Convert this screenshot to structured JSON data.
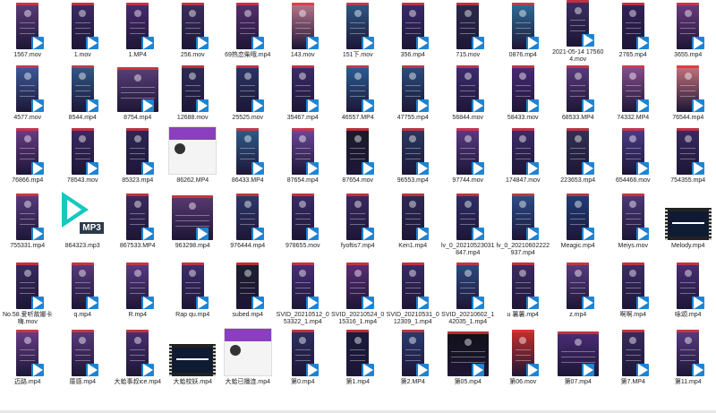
{
  "files": [
    {
      "name": "1567.mov",
      "kind": "phone",
      "bg": "#5c3d7a"
    },
    {
      "name": "1.mov",
      "kind": "phone",
      "bg": "#3d2b66"
    },
    {
      "name": "1.MP4",
      "kind": "phone",
      "bg": "#4a2c70"
    },
    {
      "name": "256.mov",
      "kind": "phone",
      "bg": "#3b2f5e"
    },
    {
      "name": "69热恋柴哦.mp4",
      "kind": "phone",
      "bg": "#57306f"
    },
    {
      "name": "143.mov",
      "kind": "phone",
      "bg": "#b9798e"
    },
    {
      "name": "151下.mov",
      "kind": "phone",
      "bg": "#2e5a86"
    },
    {
      "name": "356.mp4",
      "kind": "phone",
      "bg": "#3a2a6b"
    },
    {
      "name": "715.mov",
      "kind": "phone",
      "bg": "#2c2a4d"
    },
    {
      "name": "0876.mp4",
      "kind": "phone",
      "bg": "#2f6f9a"
    },
    {
      "name": "2021-05-14 175604.mov",
      "kind": "phone",
      "bg": "#3b2f63"
    },
    {
      "name": "2765.mp4",
      "kind": "phone",
      "bg": "#34225a"
    },
    {
      "name": "3655.mp4",
      "kind": "phone",
      "bg": "#6d3d80"
    },
    {
      "name": "4577.mov",
      "kind": "phone",
      "bg": "#3e5c9a"
    },
    {
      "name": "8544.mp4",
      "kind": "phone",
      "bg": "#315a8a"
    },
    {
      "name": "8754.mp4",
      "kind": "wide",
      "bg": "#5a3f79"
    },
    {
      "name": "12688.mov",
      "kind": "phone",
      "bg": "#2d2c59"
    },
    {
      "name": "25525.mov",
      "kind": "phone",
      "bg": "#2b3765"
    },
    {
      "name": "35467.mp4",
      "kind": "phone",
      "bg": "#3c2d69"
    },
    {
      "name": "46557.MP4",
      "kind": "phone",
      "bg": "#2b5f95"
    },
    {
      "name": "47755.mp4",
      "kind": "phone",
      "bg": "#2a4f7f"
    },
    {
      "name": "56844.mov",
      "kind": "phone",
      "bg": "#3e2d72"
    },
    {
      "name": "58433.mov",
      "kind": "phone",
      "bg": "#4b2b78"
    },
    {
      "name": "68533.MP4",
      "kind": "phone",
      "bg": "#5c3c7e"
    },
    {
      "name": "74332.MP4",
      "kind": "phone",
      "bg": "#8a4f8f"
    },
    {
      "name": "76544.mp4",
      "kind": "phone",
      "bg": "#c8747c"
    },
    {
      "name": "76866.mp4",
      "kind": "phone",
      "bg": "#6b3e86"
    },
    {
      "name": "78543.mov",
      "kind": "phone",
      "bg": "#3c2a63"
    },
    {
      "name": "85323.mp4",
      "kind": "phone",
      "bg": "#2e2857"
    },
    {
      "name": "86262.MP4",
      "kind": "doc",
      "bg": "#f4f4f4"
    },
    {
      "name": "86433.MP4",
      "kind": "phone",
      "bg": "#2e5e8f"
    },
    {
      "name": "87654.mp4",
      "kind": "phone",
      "bg": "#6e4a9a"
    },
    {
      "name": "87654.mov",
      "kind": "phone",
      "bg": "#1b1b2b"
    },
    {
      "name": "96553.mp4",
      "kind": "phone",
      "bg": "#2b3a62"
    },
    {
      "name": "97744.mov",
      "kind": "phone",
      "bg": "#5c3b86"
    },
    {
      "name": "174847.mov",
      "kind": "phone",
      "bg": "#3d2c6a"
    },
    {
      "name": "223653.mp4",
      "kind": "phone",
      "bg": "#333355"
    },
    {
      "name": "654466.mov",
      "kind": "phone",
      "bg": "#4b3d8a"
    },
    {
      "name": "754355.mp4",
      "kind": "phone",
      "bg": "#3a2a61"
    },
    {
      "name": "755331.mp4",
      "kind": "phone",
      "bg": "#5a3c80"
    },
    {
      "name": "864323.mp3",
      "kind": "mp3",
      "bg": "#17c8bf"
    },
    {
      "name": "867533.MP4",
      "kind": "phone",
      "bg": "#3b2b62"
    },
    {
      "name": "963298.mp4",
      "kind": "wide",
      "bg": "#5b3a73"
    },
    {
      "name": "976444.mp4",
      "kind": "phone",
      "bg": "#2f3a6e"
    },
    {
      "name": "978655.mov",
      "kind": "phone",
      "bg": "#3a2d68"
    },
    {
      "name": "fyoftis7.mp4",
      "kind": "phone",
      "bg": "#3b2a63"
    },
    {
      "name": "Ken1.mp4",
      "kind": "phone",
      "bg": "#2e2a56"
    },
    {
      "name": "lv_0_20210523031847.mp4",
      "kind": "phone",
      "bg": "#2f2f6a"
    },
    {
      "name": "lv_0_20210602222937.mp4",
      "kind": "phone",
      "bg": "#2d4f8a"
    },
    {
      "name": "Meagic.mp4",
      "kind": "phone",
      "bg": "#1f3f7a"
    },
    {
      "name": "Meiys.mov",
      "kind": "phone",
      "bg": "#4f3a7c"
    },
    {
      "name": "Melody.mp4",
      "kind": "film",
      "bg": "#0f1a33"
    },
    {
      "name": "No.58.爱听故娜卡嗨.mov",
      "kind": "phone",
      "bg": "#3a2b61"
    },
    {
      "name": "q.mp4",
      "kind": "phone",
      "bg": "#5a3b7f"
    },
    {
      "name": "R.mp4",
      "kind": "phone",
      "bg": "#5c3c86"
    },
    {
      "name": "Rap qu.mp4",
      "kind": "phone",
      "bg": "#3e2e6e"
    },
    {
      "name": "subed.mp4",
      "kind": "phone",
      "bg": "#1e1e2e"
    },
    {
      "name": "SVID_20210512_053322_1.mp4",
      "kind": "phone",
      "bg": "#4a2f7a"
    },
    {
      "name": "SVID_20210524_015316_1.mp4",
      "kind": "phone",
      "bg": "#5c2f76"
    },
    {
      "name": "SVID_20210531_012309_1.mp4",
      "kind": "phone",
      "bg": "#3a2b66"
    },
    {
      "name": "SVID_20210602_142035_1.mp4",
      "kind": "phone",
      "bg": "#2e4c84"
    },
    {
      "name": "u 薯薯.mp4",
      "kind": "phone",
      "bg": "#3d2c64"
    },
    {
      "name": "z.mp4",
      "kind": "phone",
      "bg": "#5a3d82"
    },
    {
      "name": "啊啊.mp4",
      "kind": "phone",
      "bg": "#3e2c68"
    },
    {
      "name": "咏颂.mp4",
      "kind": "phone",
      "bg": "#4b2f77"
    },
    {
      "name": "迈路.mp4",
      "kind": "phone",
      "bg": "#6a3e8a"
    },
    {
      "name": "厝感.mp4",
      "kind": "phone",
      "bg": "#5a3a7e"
    },
    {
      "name": "大蛤事叔ice.mp4",
      "kind": "phone",
      "bg": "#4a2f72"
    },
    {
      "name": "大蛤校妖.mp4",
      "kind": "film",
      "bg": "#f2f2f2"
    },
    {
      "name": "大蛤已播连.mp4",
      "kind": "doc",
      "bg": "#f4f4f4"
    },
    {
      "name": "第0.mp4",
      "kind": "phone",
      "bg": "#2d3060"
    },
    {
      "name": "第1.mp4",
      "kind": "phone",
      "bg": "#1a1b3a"
    },
    {
      "name": "第2.MP4",
      "kind": "phone",
      "bg": "#2b3b72"
    },
    {
      "name": "第05.mp4",
      "kind": "wide",
      "bg": "#111118"
    },
    {
      "name": "第06.mov",
      "kind": "phone",
      "bg": "#c7302a"
    },
    {
      "name": "第07.mp4",
      "kind": "wide",
      "bg": "#4b2c76"
    },
    {
      "name": "第7.MP4",
      "kind": "phone",
      "bg": "#3a2a5f"
    },
    {
      "name": "第11.mp4",
      "kind": "phone",
      "bg": "#5a3c84"
    }
  ]
}
